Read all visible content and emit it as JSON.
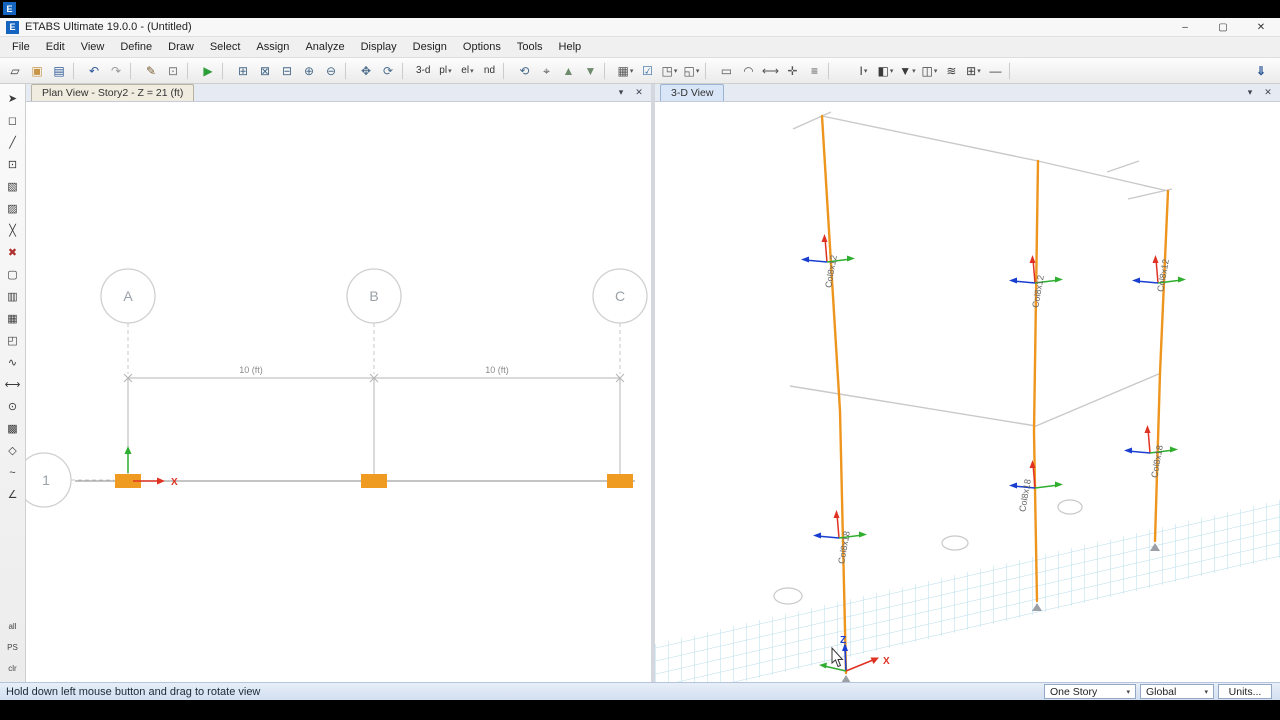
{
  "window": {
    "title": "ETABS Ultimate 19.0.0 - (Untitled)",
    "logo_letter": "E",
    "min": "–",
    "max": "▢",
    "close": "✕"
  },
  "ui": {
    "dropdown_caret": "▾"
  },
  "panel_icons": {
    "menu": "▾",
    "close": "✕"
  },
  "menubar": [
    "File",
    "Edit",
    "View",
    "Define",
    "Draw",
    "Select",
    "Assign",
    "Analyze",
    "Display",
    "Design",
    "Options",
    "Tools",
    "Help"
  ],
  "toolbar_top": [
    {
      "name": "new-model-icon",
      "glyph": "▱"
    },
    {
      "name": "open-file-icon",
      "glyph": "▣",
      "color": "#c89548"
    },
    {
      "name": "save-icon",
      "glyph": "▤",
      "color": "#2b5797"
    },
    {
      "name": "separator",
      "kind": "sep",
      "glyph": ""
    },
    {
      "name": "undo-icon",
      "glyph": "↶",
      "color": "#2b5797"
    },
    {
      "name": "redo-icon",
      "glyph": "↷",
      "color": "#9a9a9a"
    },
    {
      "name": "separator",
      "kind": "sep",
      "glyph": ""
    },
    {
      "name": "edit-drawing-icon",
      "glyph": "✎",
      "color": "#7a5c32"
    },
    {
      "name": "lock-model-icon",
      "glyph": "⊡",
      "color": "#777777"
    },
    {
      "name": "separator",
      "kind": "sep",
      "glyph": ""
    },
    {
      "name": "run-analysis-icon",
      "glyph": "▶",
      "color": "#2e9e3a"
    },
    {
      "name": "separator",
      "kind": "sep",
      "glyph": ""
    },
    {
      "name": "rubber-band-zoom-icon",
      "glyph": "⊞",
      "color": "#4a6b8a"
    },
    {
      "name": "restore-full-view-icon",
      "glyph": "⊠",
      "color": "#4a6b8a"
    },
    {
      "name": "previous-zoom-icon",
      "glyph": "⊟",
      "color": "#4a6b8a"
    },
    {
      "name": "zoom-in-icon",
      "glyph": "⊕",
      "color": "#4a6b8a"
    },
    {
      "name": "zoom-out-icon",
      "glyph": "⊖",
      "color": "#4a6b8a"
    },
    {
      "name": "separator",
      "kind": "sep",
      "glyph": ""
    },
    {
      "name": "pan-icon",
      "glyph": "✥",
      "color": "#4a6b8a"
    },
    {
      "name": "rotate-3d-view-icon",
      "glyph": "⟳",
      "color": "#4a6b8a"
    },
    {
      "name": "separator",
      "kind": "sep",
      "glyph": ""
    },
    {
      "name": "view-3d-button",
      "glyph": "3-d",
      "kind": "text"
    },
    {
      "name": "plan-view-button",
      "glyph": "pl",
      "kind": "text",
      "dd": true
    },
    {
      "name": "elevation-view-button",
      "glyph": "el",
      "kind": "text",
      "dd": true
    },
    {
      "name": "named-display-button",
      "glyph": "nd",
      "kind": "text"
    },
    {
      "name": "separator",
      "kind": "sep",
      "glyph": ""
    },
    {
      "name": "refresh-view-icon",
      "glyph": "⟲",
      "color": "#4a6b8a"
    },
    {
      "name": "find-object-icon",
      "glyph": "⌖",
      "color": "#555555"
    },
    {
      "name": "move-story-up-icon",
      "glyph": "▲",
      "color": "#6d8a6d"
    },
    {
      "name": "move-story-down-icon",
      "glyph": "▼",
      "color": "#6d8a6d"
    },
    {
      "name": "separator",
      "kind": "sep",
      "glyph": ""
    },
    {
      "name": "grid-options-icon",
      "glyph": "▦",
      "dd": true,
      "color": "#555555"
    },
    {
      "name": "show-selection-icon",
      "glyph": "☑",
      "color": "#3a6ea5"
    },
    {
      "name": "frame-display-icon",
      "glyph": "◳",
      "dd": true,
      "color": "#555555"
    },
    {
      "name": "shell-display-icon",
      "glyph": "◱",
      "dd": true,
      "color": "#555555"
    },
    {
      "name": "separator",
      "kind": "sep",
      "glyph": ""
    },
    {
      "name": "draw-rect-icon",
      "glyph": "▭",
      "color": "#555555"
    },
    {
      "name": "snap-arc-icon",
      "glyph": "◠",
      "color": "#555555"
    },
    {
      "name": "measure-icon",
      "glyph": "⟷",
      "color": "#555555"
    },
    {
      "name": "axes-icon",
      "glyph": "✛",
      "color": "#555555"
    },
    {
      "name": "list-icon",
      "glyph": "≡",
      "color": "#555555"
    },
    {
      "name": "separator",
      "kind": "sep",
      "glyph": ""
    }
  ],
  "toolbar_right": [
    {
      "name": "text-select-icon",
      "glyph": "I",
      "dd": true
    },
    {
      "name": "object-view-options-icon",
      "glyph": "◧",
      "dd": true
    },
    {
      "name": "filter-icon",
      "glyph": "▼",
      "dd": true
    },
    {
      "name": "section-display-icon",
      "glyph": "◫",
      "dd": true
    },
    {
      "name": "hatch-display-icon",
      "glyph": "≋"
    },
    {
      "name": "tables-icon",
      "glyph": "⊞",
      "dd": true
    },
    {
      "name": "line-style-icon",
      "glyph": "—"
    },
    {
      "name": "separator",
      "kind": "sep",
      "glyph": ""
    }
  ],
  "toolbar_download": {
    "glyph": "⇓"
  },
  "toolbar_left": [
    {
      "name": "select-pointer-icon",
      "glyph": "➤"
    },
    {
      "name": "reshape-object-icon",
      "glyph": "◻"
    },
    {
      "name": "draw-line-icon",
      "glyph": "╱"
    },
    {
      "name": "draw-joint-icon",
      "glyph": "⊡"
    },
    {
      "name": "draw-frame-icon",
      "glyph": "▧"
    },
    {
      "name": "quick-draw-frame-icon",
      "glyph": "▨"
    },
    {
      "name": "quick-draw-braces-icon",
      "glyph": "╳"
    },
    {
      "name": "delete-object-icon",
      "glyph": "✖",
      "color": "#b03030"
    },
    {
      "name": "draw-floor-icon",
      "glyph": "▢"
    },
    {
      "name": "draw-wall-icon",
      "glyph": "▥"
    },
    {
      "name": "quick-draw-floor-icon",
      "glyph": "▦"
    },
    {
      "name": "quick-draw-wall-icon",
      "glyph": "◰"
    },
    {
      "name": "draw-link-icon",
      "glyph": "∿"
    },
    {
      "name": "draw-dimension-icon",
      "glyph": "⟷"
    },
    {
      "name": "draw-reference-icon",
      "glyph": "⊙"
    },
    {
      "name": "snap-grid-icon",
      "glyph": "▩"
    },
    {
      "name": "snap-point-icon",
      "glyph": "◇"
    },
    {
      "name": "snap-line-icon",
      "glyph": "~"
    },
    {
      "name": "snap-perp-icon",
      "glyph": "∠"
    }
  ],
  "toolbar_left_bottom": [
    {
      "name": "show-all-button",
      "glyph": "all",
      "kind": "text"
    },
    {
      "name": "ps-button",
      "glyph": "PS",
      "kind": "text"
    },
    {
      "name": "clear-button",
      "glyph": "clr",
      "kind": "text"
    }
  ],
  "plan_panel": {
    "tab_title": "Plan View - Story2 - Z = 21 (ft)",
    "grid_labels": [
      "A",
      "B",
      "C",
      "1"
    ],
    "dim_ab": "10 (ft)",
    "dim_bc": "10 (ft)",
    "x_axis_label": "X"
  },
  "view3d_panel": {
    "tab_title": "3-D View",
    "col_labels": {
      "top": "Col8x12",
      "bottom": "Col8x18"
    },
    "z_axis_label": "Z",
    "x_axis_label": "X"
  },
  "statusbar": {
    "message": "Hold down left mouse button and drag to rotate view",
    "story_mode": "One Story",
    "coord_system": "Global",
    "units": "Units...",
    "dropdown_icon": "▾"
  },
  "colors": {
    "column_orange": "#ef9b22",
    "grid_cyan": "#b5dcec",
    "axis_red": "#e03223",
    "axis_green": "#2fae2f",
    "axis_blue": "#1a3fd0"
  }
}
